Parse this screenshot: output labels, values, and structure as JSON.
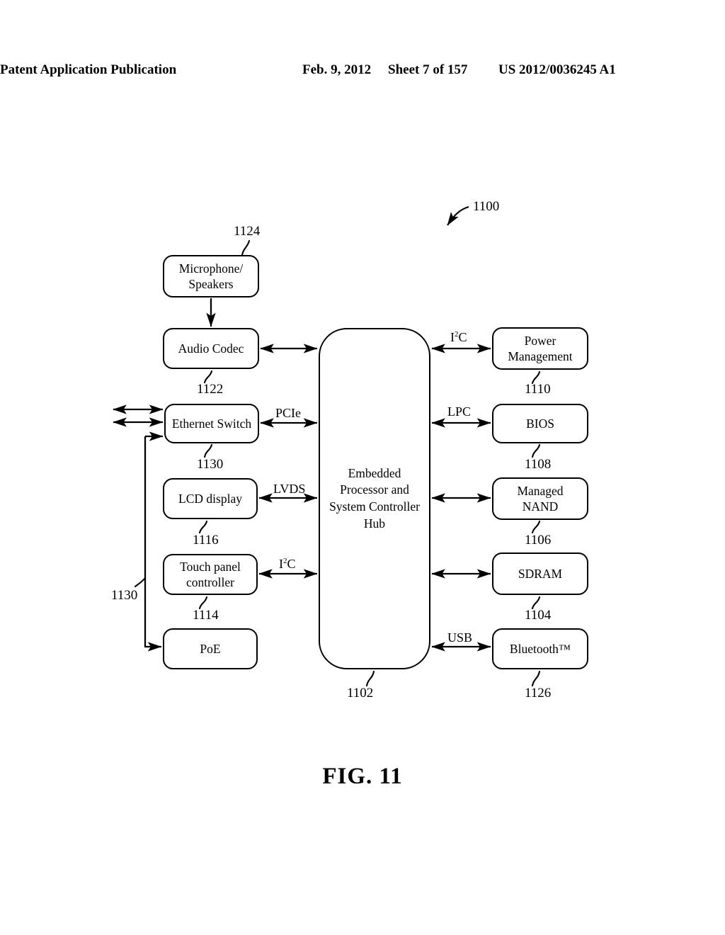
{
  "header": {
    "publication": "Patent Application Publication",
    "date": "Feb. 9, 2012",
    "sheet": "Sheet 7 of 157",
    "patent_number": "US 2012/0036245 A1"
  },
  "figure": {
    "caption": "FIG. 11",
    "system_ref": "1100"
  },
  "blocks": {
    "microphone_speakers": {
      "label": "Microphone/\nSpeakers",
      "ref": "1124"
    },
    "audio_codec": {
      "label": "Audio Codec",
      "ref": "1122"
    },
    "ethernet_switch": {
      "label": "Ethernet Switch",
      "ref": "1130"
    },
    "lcd_display": {
      "label": "LCD display",
      "ref": "1116"
    },
    "touch_panel": {
      "label": "Touch panel\ncontroller",
      "ref": "1114"
    },
    "poe": {
      "label": "PoE",
      "ref": "1130"
    },
    "hub": {
      "label": "Embedded\nProcessor and\nSystem Controller\nHub",
      "ref": "1102"
    },
    "power_management": {
      "label": "Power\nManagement",
      "ref": "1110"
    },
    "bios": {
      "label": "BIOS",
      "ref": "1108"
    },
    "managed_nand": {
      "label": "Managed\nNAND",
      "ref": "1106"
    },
    "sdram": {
      "label": "SDRAM",
      "ref": "1104"
    },
    "bluetooth": {
      "label": "Bluetooth™",
      "ref": "1126"
    }
  },
  "bus_labels": {
    "pcie": "PCIe",
    "lvds": "LVDS",
    "i2c_touch_pre": "I",
    "i2c_touch_sup": "2",
    "i2c_touch_post": "C",
    "i2c_power_pre": "I",
    "i2c_power_sup": "2",
    "i2c_power_post": "C",
    "lpc": "LPC",
    "usb": "USB"
  },
  "chart_data": {
    "type": "diagram",
    "title": "FIG. 11",
    "nodes": [
      {
        "id": "1124",
        "label": "Microphone/Speakers",
        "column": "left",
        "row": 0
      },
      {
        "id": "1122",
        "label": "Audio Codec",
        "column": "left",
        "row": 1
      },
      {
        "id": "1130a",
        "label": "Ethernet Switch",
        "column": "left",
        "row": 2
      },
      {
        "id": "1116",
        "label": "LCD display",
        "column": "left",
        "row": 3
      },
      {
        "id": "1114",
        "label": "Touch panel controller",
        "column": "left",
        "row": 4
      },
      {
        "id": "1130b",
        "label": "PoE",
        "column": "left",
        "row": 5
      },
      {
        "id": "1102",
        "label": "Embedded Processor and System Controller Hub",
        "column": "center",
        "row": 0
      },
      {
        "id": "1110",
        "label": "Power Management",
        "column": "right",
        "row": 0
      },
      {
        "id": "1108",
        "label": "BIOS",
        "column": "right",
        "row": 1
      },
      {
        "id": "1106",
        "label": "Managed NAND",
        "column": "right",
        "row": 2
      },
      {
        "id": "1104",
        "label": "SDRAM",
        "column": "right",
        "row": 3
      },
      {
        "id": "1126",
        "label": "Bluetooth™",
        "column": "right",
        "row": 4
      }
    ],
    "edges": [
      {
        "from": "1124",
        "to": "1122",
        "bus": "",
        "direction": "one-way"
      },
      {
        "from": "1122",
        "to": "1102",
        "bus": "",
        "direction": "two-way"
      },
      {
        "from": "1130a",
        "to": "1102",
        "bus": "PCIe",
        "direction": "two-way"
      },
      {
        "from": "1116",
        "to": "1102",
        "bus": "LVDS",
        "direction": "two-way"
      },
      {
        "from": "1114",
        "to": "1102",
        "bus": "I2C",
        "direction": "two-way"
      },
      {
        "from": "1102",
        "to": "1110",
        "bus": "I2C",
        "direction": "two-way"
      },
      {
        "from": "1102",
        "to": "1108",
        "bus": "LPC",
        "direction": "two-way"
      },
      {
        "from": "1102",
        "to": "1106",
        "bus": "",
        "direction": "two-way"
      },
      {
        "from": "1102",
        "to": "1104",
        "bus": "",
        "direction": "two-way"
      },
      {
        "from": "1102",
        "to": "1126",
        "bus": "USB",
        "direction": "two-way"
      },
      {
        "from": "1130a",
        "to": "1130b",
        "bus": "",
        "direction": "one-way"
      },
      {
        "from": "external",
        "to": "1130a",
        "bus": "",
        "direction": "two-way"
      },
      {
        "from": "external2",
        "to": "1130a",
        "bus": "",
        "direction": "two-way"
      }
    ]
  }
}
